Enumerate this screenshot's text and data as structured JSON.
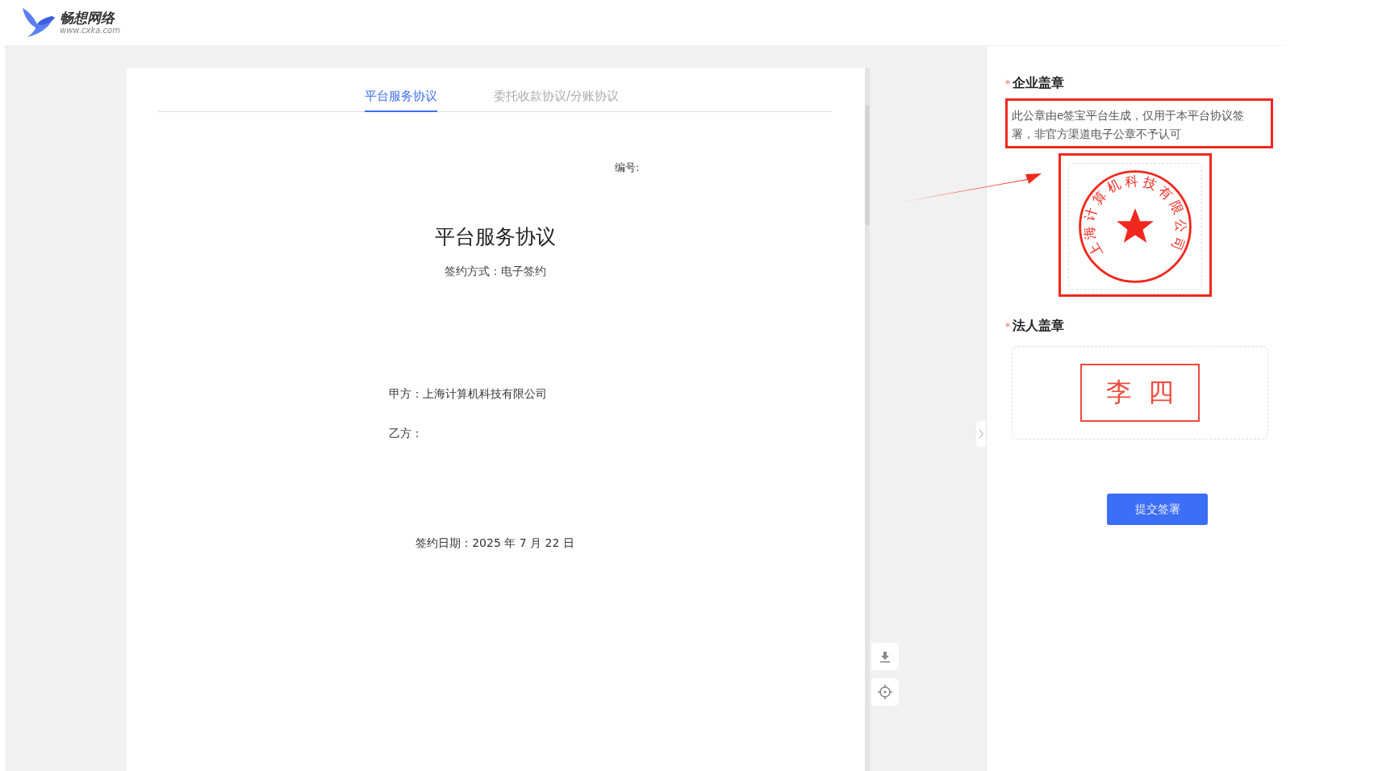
{
  "header": {
    "logo_name": "畅想网络",
    "logo_url": "www.cxka.com"
  },
  "tabs": [
    {
      "label": "平台服务协议",
      "selected": true
    },
    {
      "label": "委托收款协议/分账协议",
      "selected": false
    }
  ],
  "document": {
    "number_label": "编号:",
    "title": "平台服务协议",
    "method": "签约方式：电子签约",
    "party_a": "甲方：上海计算机科技有限公司",
    "party_b": "乙方：",
    "date": "签约日期：2025 年 7 月 22 日"
  },
  "side_panel": {
    "company_seal": {
      "required_mark": "*",
      "label": "企业盖章",
      "notice": "此公章由e签宝平台生成，仅用于本平台协议签署，非官方渠道电子公章不予认可",
      "seal_text": "上海计算机科技有限公司"
    },
    "legal_seal": {
      "required_mark": "*",
      "label": "法人盖章",
      "name": "李四"
    },
    "submit": "提交签署"
  }
}
